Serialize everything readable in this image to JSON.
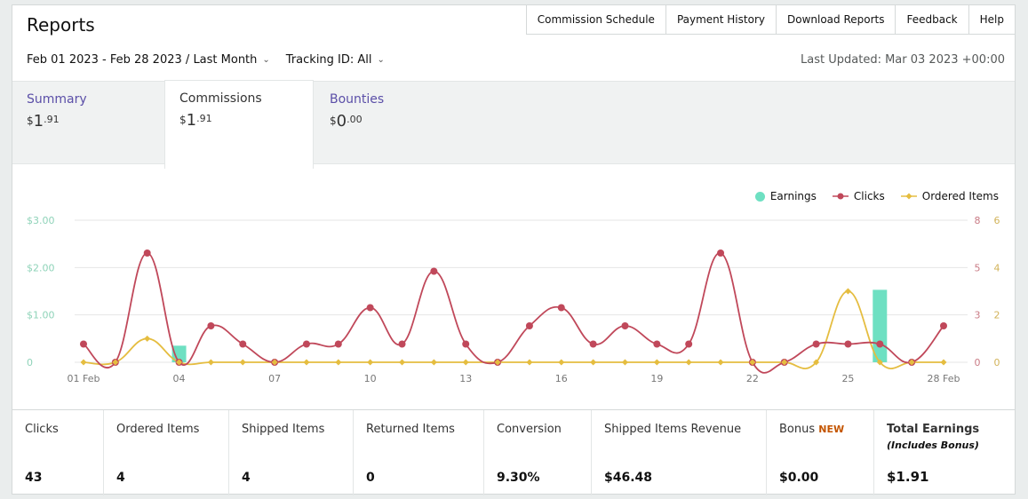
{
  "header": {
    "title": "Reports",
    "nav": [
      "Commission Schedule",
      "Payment History",
      "Download Reports",
      "Feedback",
      "Help"
    ]
  },
  "filters": {
    "date_range": "Feb 01 2023 - Feb 28 2023",
    "separator": " / ",
    "period": "Last Month",
    "tracking": "Tracking ID: All",
    "last_updated": "Last Updated: Mar 03 2023 +00:00"
  },
  "tabs": [
    {
      "label": "Summary",
      "currency": "$",
      "whole": "1",
      "cents": ".91"
    },
    {
      "label": "Commissions",
      "currency": "$",
      "whole": "1",
      "cents": ".91"
    },
    {
      "label": "Bounties",
      "currency": "$",
      "whole": "0",
      "cents": ".00"
    }
  ],
  "colors": {
    "earnings": "#6ee0c2",
    "clicks": "#c0485a",
    "ordered": "#e5bd40",
    "link": "#5b4fa8",
    "new_badge": "#c45500"
  },
  "chart_data": {
    "type": "line",
    "legend": [
      "Earnings",
      "Clicks",
      "Ordered Items"
    ],
    "legend_position": "top-right",
    "x_tick_labels": [
      "01 Feb",
      "04",
      "07",
      "10",
      "13",
      "16",
      "19",
      "22",
      "25",
      "28 Feb"
    ],
    "x_tick_days": [
      1,
      4,
      7,
      10,
      13,
      16,
      19,
      22,
      25,
      28
    ],
    "y_left_ticks": [
      "$3.00",
      "$2.00",
      "$1.00",
      "0"
    ],
    "y_left_values": [
      3,
      2,
      1,
      0
    ],
    "y_mid_ticks": [
      "8",
      "5",
      "3",
      "0"
    ],
    "y_right_ticks": [
      "6",
      "4",
      "2",
      "0"
    ],
    "y_left_max": 3,
    "y_clicks_max": 8,
    "y_ordered_max": 6,
    "days": [
      1,
      2,
      3,
      4,
      5,
      6,
      7,
      8,
      9,
      10,
      11,
      12,
      13,
      14,
      15,
      16,
      17,
      18,
      19,
      20,
      21,
      22,
      23,
      24,
      25,
      26,
      27,
      28
    ],
    "series": [
      {
        "name": "Clicks",
        "values": [
          1,
          0,
          6,
          0,
          2,
          1,
          0,
          1,
          1,
          3,
          1,
          5,
          1,
          0,
          2,
          3,
          1,
          2,
          1,
          1,
          6,
          0,
          0,
          1,
          1,
          1,
          0,
          2
        ]
      },
      {
        "name": "Ordered Items",
        "values": [
          0,
          0,
          1,
          0,
          0,
          0,
          0,
          0,
          0,
          0,
          0,
          0,
          0,
          0,
          0,
          0,
          0,
          0,
          0,
          0,
          0,
          0,
          0,
          0,
          3,
          0,
          0,
          0
        ]
      },
      {
        "name": "Earnings",
        "values": [
          0,
          0,
          0,
          0.35,
          0,
          0,
          0,
          0,
          0,
          0,
          0,
          0,
          0,
          0,
          0,
          0,
          0,
          0,
          0,
          0,
          0,
          0,
          0,
          0,
          0,
          1.53,
          0,
          0
        ]
      }
    ]
  },
  "stats": [
    {
      "label": "Clicks",
      "value": "43"
    },
    {
      "label": "Ordered Items",
      "value": "4"
    },
    {
      "label": "Shipped Items",
      "value": "4"
    },
    {
      "label": "Returned Items",
      "value": "0"
    },
    {
      "label": "Conversion",
      "value": "9.30%"
    },
    {
      "label": "Shipped Items Revenue",
      "value": "$46.48"
    },
    {
      "label": "Bonus",
      "badge": "NEW",
      "value": "$0.00"
    },
    {
      "label": "Total Earnings",
      "sublabel": "(Includes Bonus)",
      "value": "$1.91"
    }
  ]
}
